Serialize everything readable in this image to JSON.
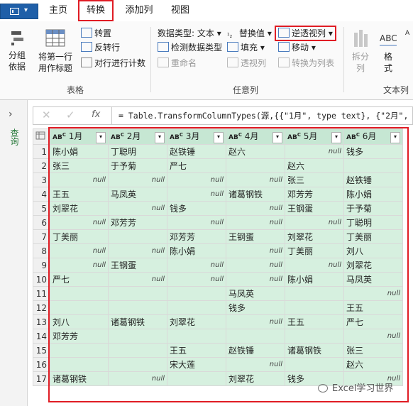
{
  "tabs": [
    "主页",
    "转换",
    "添加列",
    "视图"
  ],
  "ribbon": {
    "table_group": {
      "label": "表格",
      "group_by": "分组\n依据",
      "first_row_header": "将第一行\n用作标题",
      "transpose": "转置",
      "reverse_rows": "反转行",
      "count_rows": "对行进行计数"
    },
    "any_column_group": {
      "label": "任意列",
      "data_type": "数据类型: 文本",
      "detect_type": "检测数据类型",
      "rename": "重命名",
      "replace_values": "替换值",
      "fill": "填充",
      "pivot": "透视列",
      "unpivot": "逆透视列",
      "move": "移动",
      "to_list": "转换为列表"
    },
    "text_column_group": {
      "label": "文本列",
      "split_column": "拆分\n列",
      "format": "格\n式"
    }
  },
  "left_pane": {
    "label": "查询"
  },
  "formula_bar": {
    "fx": "fx",
    "text": "= Table.TransformColumnTypes(源,{{\"1月\", type text}, {\"2月\", typ"
  },
  "grid": {
    "columns": [
      "1月",
      "2月",
      "3月",
      "4月",
      "5月",
      "6月"
    ],
    "type_prefix": "AB",
    "type_suffix": "C",
    "rows": [
      [
        "陈小娟",
        "丁聪明",
        "赵铁锤",
        "赵六",
        "null",
        "钱多"
      ],
      [
        "张三",
        "于予菊",
        "严七",
        "",
        "赵六",
        ""
      ],
      [
        "null",
        "null",
        "null",
        "null",
        "张三",
        "赵铁锤"
      ],
      [
        "王五",
        "马凤英",
        "null",
        "诸葛钢铁",
        "邓芳芳",
        "陈小娟"
      ],
      [
        "刘翠花",
        "null",
        "钱多",
        "null",
        "王钢蛋",
        "于予菊"
      ],
      [
        "null",
        "邓芳芳",
        "null",
        "null",
        "null",
        "丁聪明"
      ],
      [
        "丁美丽",
        "",
        "邓芳芳",
        "王钢蛋",
        "刘翠花",
        "丁美丽"
      ],
      [
        "null",
        "null",
        "陈小娟",
        "null",
        "丁美丽",
        "刘八"
      ],
      [
        "null",
        "王钢蛋",
        "null",
        "null",
        "null",
        "刘翠花"
      ],
      [
        "严七",
        "null",
        "null",
        "null",
        "陈小娟",
        "马凤英"
      ],
      [
        "",
        "",
        "",
        "马凤英",
        "",
        "null"
      ],
      [
        "",
        "",
        "",
        "钱多",
        "",
        "王五"
      ],
      [
        "刘八",
        "诸葛钢铁",
        "刘翠花",
        "null",
        "王五",
        "严七"
      ],
      [
        "邓芳芳",
        "",
        "",
        "",
        "",
        "null"
      ],
      [
        "",
        "",
        "王五",
        "赵铁锤",
        "诸葛钢铁",
        "张三"
      ],
      [
        "",
        "",
        "宋大莲",
        "null",
        "",
        "赵六"
      ],
      [
        "诸葛钢铁",
        "null",
        "",
        "刘翠花",
        "钱多",
        "null"
      ]
    ]
  },
  "watermark": "Excel学习世界"
}
